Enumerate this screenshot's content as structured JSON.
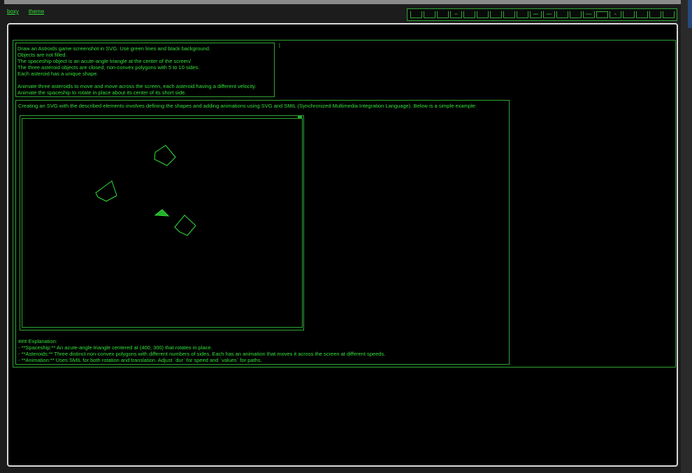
{
  "nav": {
    "links": [
      "boxy",
      "theme"
    ]
  },
  "toolbar": {
    "buttons": [
      {
        "label": "",
        "active": false
      },
      {
        "label": "",
        "active": false
      },
      {
        "label": "",
        "active": false
      },
      {
        "label": "wh",
        "active": false
      },
      {
        "label": "",
        "active": false
      },
      {
        "label": "",
        "active": false
      },
      {
        "label": "",
        "active": false
      },
      {
        "label": "",
        "active": false
      },
      {
        "label": "",
        "active": false
      },
      {
        "label": "sable",
        "active": false
      },
      {
        "label": "share",
        "active": false
      },
      {
        "label": "",
        "active": false
      },
      {
        "label": "",
        "active": false
      },
      {
        "label": "history",
        "active": false
      },
      {
        "label": "",
        "active": true
      },
      {
        "label": "fix",
        "active": false
      },
      {
        "label": "",
        "active": false
      },
      {
        "label": "",
        "active": false
      },
      {
        "label": "",
        "active": false
      },
      {
        "label": "",
        "active": false
      }
    ]
  },
  "prompt": {
    "lines": [
      "Draw an Astroids game screenshot in SVG. Use green lines and black background.",
      "Objects are not filled.",
      "The spaceship object is an acute-angle triangle at the center of the screen/",
      "The three asteroid objects are closed, non-convex polygons with 5 to 10 sides.",
      "Each asteroid has a unique shape.",
      "",
      "Animate three asteroids to move and move across the screen, each asteroid having a different velocity.",
      "Animate the spaceship to rotate in place about its center of its short side."
    ],
    "cursor": "|"
  },
  "response": {
    "intro": "Creating an SVG with the described elements involves defining the shapes and adding animations using SVG and SMIL (Synchronized Multimedia Integration Language). Below is a simple example:",
    "explanation": [
      "### Explanation:",
      "- **Spaceship:** An acute-angle triangle centered at (400, 300) that rotates in place.",
      "- **Asteroids:** Three distinct non-convex polygons with different numbers of sides. Each has an animation that moves it across the screen at different speeds.",
      "- **Animation:** Uses SMIL for both rotation and translation. Adjust `dur` for speed and `values` for paths."
    ]
  },
  "colors": {
    "accent": "#33e03a",
    "border": "#2fa533",
    "background": "#000000",
    "frame": "#d8d8d8"
  }
}
